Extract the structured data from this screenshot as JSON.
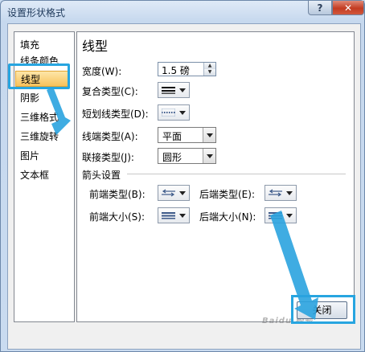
{
  "window": {
    "title": "设置形状格式",
    "help_label": "?",
    "close_label": "✕"
  },
  "nav": {
    "items": [
      {
        "label": "填充"
      },
      {
        "label": "线条颜色"
      },
      {
        "label": "线型"
      },
      {
        "label": "阴影"
      },
      {
        "label": "三维格式"
      },
      {
        "label": "三维旋转"
      },
      {
        "label": "图片"
      },
      {
        "label": "文本框"
      }
    ],
    "selected_index": 2
  },
  "panel": {
    "title": "线型",
    "width_label": "宽度(W):",
    "width_value": "1.5 磅",
    "compound_label": "复合类型(C):",
    "dash_label": "短划线类型(D):",
    "cap_label": "线端类型(A):",
    "cap_value": "平面",
    "join_label": "联接类型(J):",
    "join_value": "圆形",
    "arrow_section_label": "箭头设置",
    "begin_type_label": "前端类型(B):",
    "end_type_label": "后端类型(E):",
    "begin_size_label": "前端大小(S):",
    "end_size_label": "后端大小(N):"
  },
  "footer": {
    "close_button": "关闭"
  },
  "watermark": "Baidu 经验",
  "colors": {
    "highlight": "#27a5e0",
    "selection": "#f8c25c"
  }
}
